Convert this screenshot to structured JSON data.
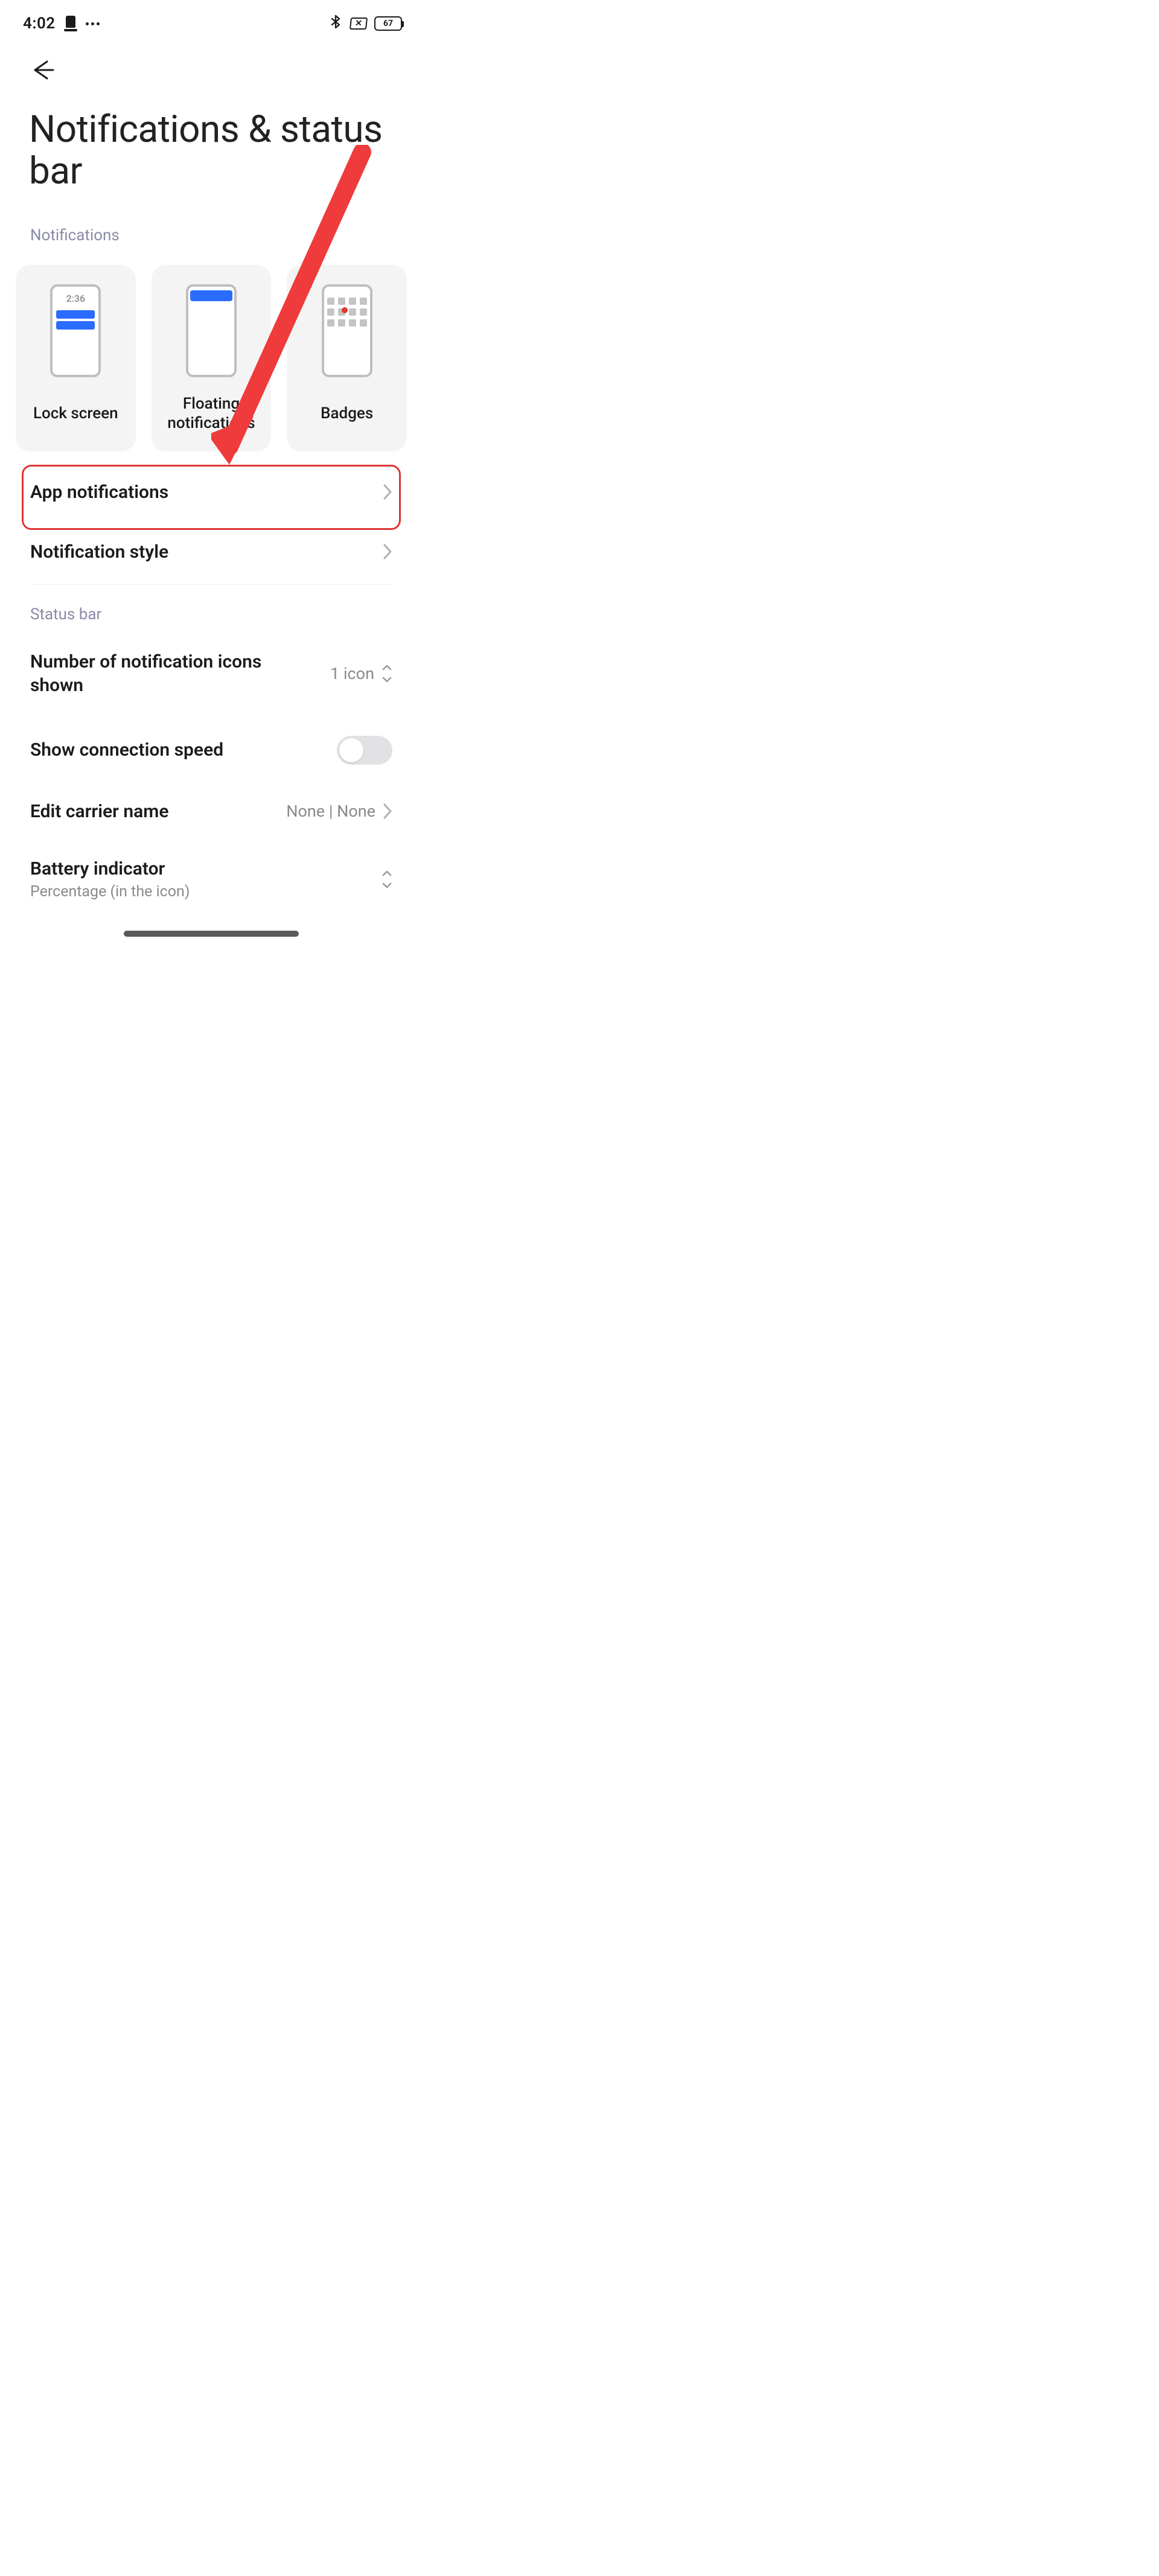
{
  "status_bar": {
    "time": "4:02",
    "battery_percent": "67"
  },
  "page_title": "Notifications & status bar",
  "sections": {
    "notifications_label": "Notifications",
    "status_bar_label": "Status bar"
  },
  "cards": {
    "lock_screen": {
      "label": "Lock screen",
      "preview_time": "2:36"
    },
    "floating": {
      "label": "Floating notifications"
    },
    "badges": {
      "label": "Badges"
    }
  },
  "items": {
    "app_notifications": {
      "label": "App notifications"
    },
    "notification_style": {
      "label": "Notification style"
    },
    "num_icons": {
      "label": "Number of notification icons shown",
      "value": "1 icon"
    },
    "show_connection_speed": {
      "label": "Show connection speed",
      "enabled": false
    },
    "edit_carrier": {
      "label": "Edit carrier name",
      "value": "None | None"
    },
    "battery_indicator": {
      "label": "Battery indicator",
      "value": "Percentage (in the icon)"
    }
  }
}
